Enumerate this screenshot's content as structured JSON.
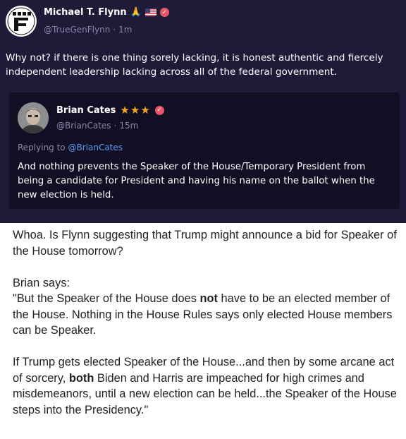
{
  "tweet": {
    "author": {
      "name": "Michael T. Flynn",
      "handle": "@TrueGenFlynn",
      "sep": "·",
      "time": "1m",
      "emoji": "🙏"
    },
    "text": "Why not? if there is one thing sorely lacking, it is honest authentic and fiercely independent leadership lacking across all of the federal government."
  },
  "quoted": {
    "author": {
      "name": "Brian Cates",
      "stars": "★★★",
      "handle": "@BrianCates",
      "sep": "·",
      "time": "15m"
    },
    "replying_prefix": "Replying to",
    "replying_to": "@BrianCates",
    "text": "And nothing prevents the Speaker of the House/Temporary President from being a candidate for President and having his name on the ballot when the new election is held."
  },
  "commentary": {
    "p1": "Whoa. Is Flynn suggesting that Trump might announce a bid for Speaker of the House tomorrow?",
    "p2_intro": "Brian says:",
    "p2_a": "\"But the Speaker of the House does ",
    "p2_bold": "not",
    "p2_b": " have to be an elected member of the House.  Nothing in the House Rules says only elected House members can be Speaker.",
    "p3_a": "If Trump gets elected Speaker of the House...and then by some arcane act of sorcery, ",
    "p3_bold": "both",
    "p3_b": " Biden and Harris are impeached for high crimes and misdemeanors, until a new election can be held...the Speaker of the House steps into the Presidency.\""
  },
  "colors": {
    "card_bg": "#1e1a38",
    "quote_bg": "#110f24",
    "muted": "#8a87a8",
    "mention": "#5a9cf0",
    "badge": "#e8546a",
    "stars": "#f2a623"
  },
  "icons": [
    "truth-social-logo-icon",
    "praying-hands-icon",
    "us-flag-icon",
    "verified-badge-icon",
    "star-icon"
  ]
}
